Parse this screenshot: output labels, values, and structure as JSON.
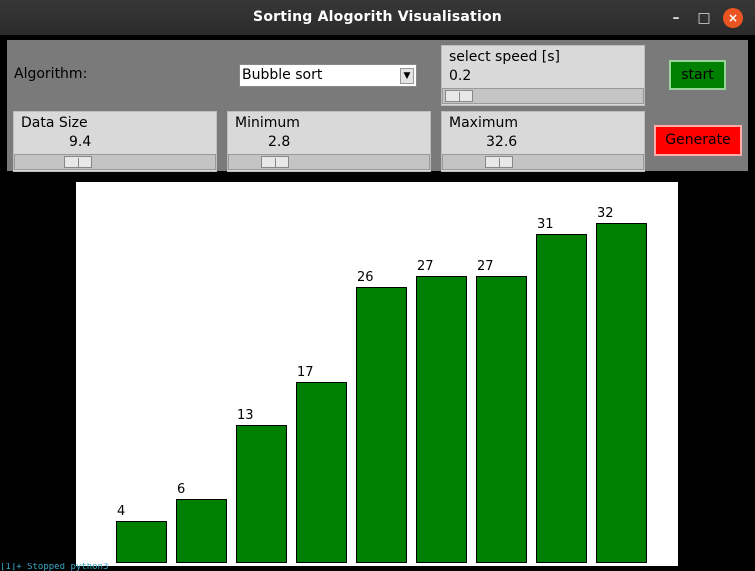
{
  "window": {
    "title": "Sorting Alogorith Visualisation",
    "buttons": [
      "–",
      "□",
      "×"
    ]
  },
  "controls": {
    "algorithm_label": "Algorithm:",
    "algorithm_value": "Bubble sort",
    "speed": {
      "label": "select speed [s]",
      "value": "0.2",
      "fraction": 0.0
    },
    "start_label": "start",
    "data_size": {
      "label": "Data Size",
      "value": "9.4",
      "fraction": 0.28
    },
    "minimum": {
      "label": "Minimum",
      "value": "2.8",
      "fraction": 0.18
    },
    "maximum": {
      "label": "Maximum",
      "value": "32.6",
      "fraction": 0.24
    },
    "generate_label": "Generate"
  },
  "colors": {
    "bar": "#008000",
    "start_button": "#008000",
    "generate_button": "#ff0000",
    "close_button": "#e95420"
  },
  "chart_data": {
    "type": "bar",
    "values": [
      4,
      6,
      13,
      17,
      26,
      27,
      27,
      31,
      32
    ],
    "title": "",
    "xlabel": "",
    "ylabel": ""
  },
  "terminal_text": "[1]+ Stopped python3"
}
